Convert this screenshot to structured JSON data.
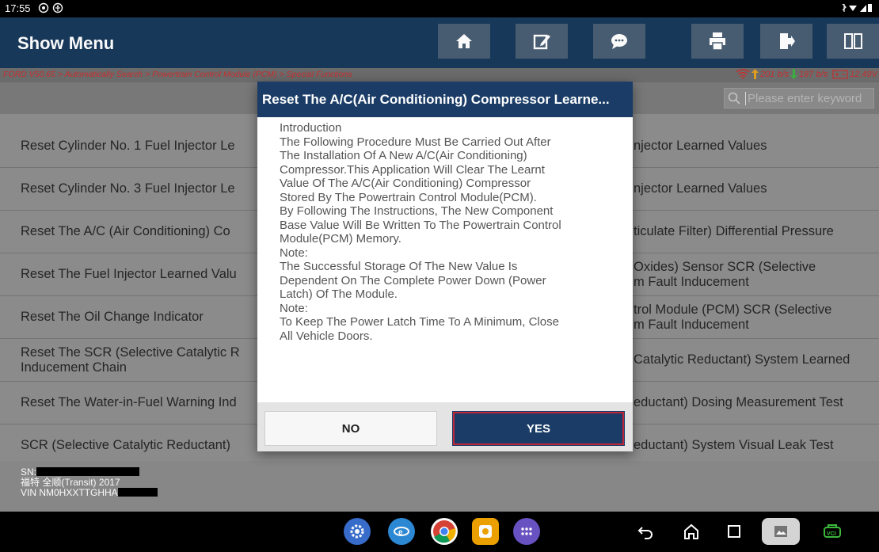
{
  "status_bar": {
    "time": "17:55",
    "left_icons": [
      "whatsapp-icon",
      "accessibility-icon"
    ],
    "right_icons": [
      "bluetooth-icon",
      "wifi-icon",
      "battery-icon"
    ]
  },
  "header": {
    "title": "Show Menu",
    "buttons": [
      "home-icon",
      "edit-report-icon",
      "chat-icon",
      "print-icon",
      "exit-icon",
      "multi-window-icon"
    ]
  },
  "breadcrumb": "FORD V50.65 > Automatically Search > Powertrain Control Module (PCM) > Special Functions",
  "network": {
    "upload": "201 b/s",
    "download": "187 b/s",
    "voltage": "12.49V"
  },
  "search": {
    "placeholder": "Please enter keyword"
  },
  "menu": {
    "left": [
      "Reset Cylinder No. 1 Fuel Injector Le",
      "Reset Cylinder No. 3 Fuel Injector Le",
      "Reset The A/C (Air Conditioning) Co",
      "Reset The Fuel Injector Learned Valu",
      "Reset The Oil Change Indicator",
      "Reset The SCR (Selective Catalytic R|Inducement Chain",
      "Reset The Water-in-Fuel Warning Ind",
      "SCR (Selective Catalytic Reductant)"
    ],
    "right": [
      "njector Learned Values",
      "njector Learned Values",
      "ticulate Filter) Differential Pressure",
      "Oxides) Sensor SCR (Selective|m Fault Inducement",
      "trol Module (PCM) SCR (Selective|m Fault Inducement",
      "Catalytic Reductant) System Learned",
      "eductant) Dosing Measurement Test",
      "eductant) System Visual Leak Test"
    ]
  },
  "vehicle": {
    "sn_label": "SN:",
    "model": "福特 全顺(Transit) 2017",
    "vin_label": "VIN NM0HXXTTGHHA"
  },
  "dialog": {
    "title": "Reset The A/C(Air Conditioning) Compressor Learne...",
    "body_lines": [
      "Introduction",
      "The Following Procedure Must Be Carried Out After",
      "The Installation Of A New A/C(Air Conditioning)",
      "Compressor.This Application Will Clear The Learnt",
      "Value Of The A/C(Air Conditioning) Compressor",
      "Stored By The Powertrain Control Module(PCM).",
      "By Following The Instructions, The New Component",
      "Base Value Will Be Written To The Powertrain Control",
      "Module(PCM) Memory.",
      "Note:",
      "The Successful Storage Of The New Value Is",
      "Dependent On The Complete Power Down (Power",
      "Latch) Of The Module.",
      "Note:",
      "To Keep The Power Latch Time To A Minimum, Close",
      "All Vehicle Doors."
    ],
    "no_label": "NO",
    "yes_label": "YES"
  },
  "nav_bar": {
    "apps": [
      "settings-icon",
      "browser-icon",
      "chrome-icon",
      "app-icon",
      "all-apps-icon"
    ],
    "controls": [
      "back-icon",
      "home-nav-icon",
      "recents-icon",
      "screenshot-icon",
      "vci-icon"
    ]
  },
  "colors": {
    "header_bg": "#193a5c",
    "dialog_title_bg": "#1a3c66",
    "breadcrumb_text": "#c93030",
    "yes_outline": "#c0263a"
  }
}
